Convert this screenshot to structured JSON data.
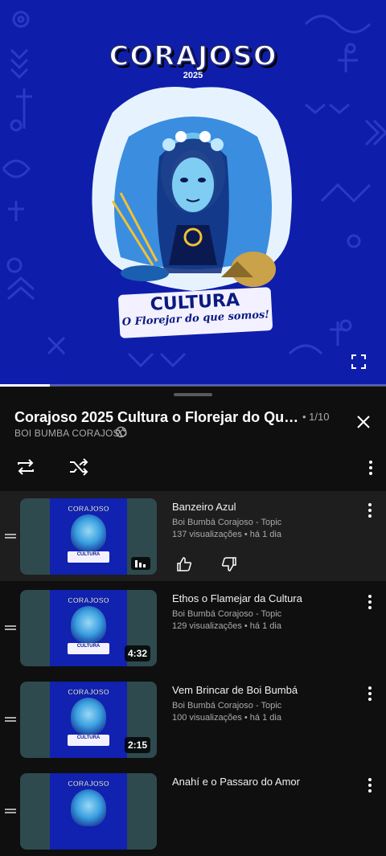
{
  "video": {
    "artwork": {
      "title": "CORAJOSO",
      "year": "2025",
      "banner_title": "CULTURA",
      "banner_subtitle": "O Florejar do que somos!"
    },
    "progress": 0.13,
    "fullscreen_icon": "fullscreen-icon"
  },
  "playlist": {
    "title": "Corajoso 2025 Cultura o Florejar do Que ...",
    "index": "• 1/10",
    "channel": "BOI BUMBA CORAJOSO",
    "channel_icon": "globe-icon",
    "controls": {
      "loop_icon": "loop-icon",
      "shuffle_icon": "shuffle-icon",
      "more_icon": "more-vert-icon"
    },
    "items": [
      {
        "title": "Banzeiro Azul",
        "channel": "Boi Bumbá Corajoso - Topic",
        "meta": "137 visualizações • há 1 dia",
        "duration": "",
        "active": true,
        "thumb_title": "CORAJOSO",
        "thumb_banner": "CULTURA"
      },
      {
        "title": "Ethos o Flamejar da Cultura",
        "channel": "Boi Bumbá Corajoso - Topic",
        "meta": "129 visualizações • há 1 dia",
        "duration": "4:32",
        "active": false,
        "thumb_title": "CORAJOSO",
        "thumb_banner": "CULTURA"
      },
      {
        "title": "Vem Brincar de Boi Bumbá",
        "channel": "Boi Bumbá Corajoso - Topic",
        "meta": "100 visualizações • há 1 dia",
        "duration": "2:15",
        "active": false,
        "thumb_title": "CORAJOSO",
        "thumb_banner": "CULTURA"
      },
      {
        "title": "Anahí e o Passaro do Amor",
        "channel": "",
        "meta": "",
        "duration": "",
        "active": false,
        "thumb_title": "CORAJOSO",
        "thumb_banner": ""
      }
    ]
  },
  "colors": {
    "video_bg": "#0e1eab",
    "sheet_bg": "#0f0f0f",
    "active_row": "#1e1e1e",
    "thumb_bg": "#2e4a4e"
  }
}
